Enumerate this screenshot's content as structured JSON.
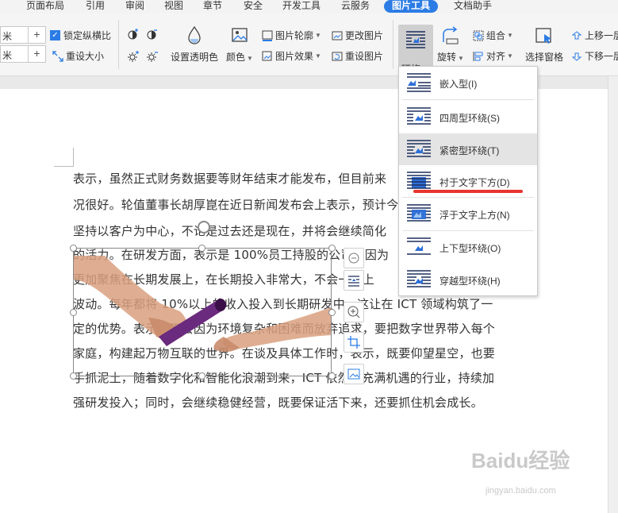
{
  "menu_tabs": [
    {
      "label": "页面布局"
    },
    {
      "label": "引用"
    },
    {
      "label": "审阅"
    },
    {
      "label": "视图"
    },
    {
      "label": "章节"
    },
    {
      "label": "安全"
    },
    {
      "label": "开发工具"
    },
    {
      "label": "云服务"
    },
    {
      "label": "图片工具",
      "active": true
    },
    {
      "label": "文档助手"
    }
  ],
  "ribbon": {
    "size_unit": "米",
    "lock_ratio": "锁定纵横比",
    "reset_size": "重设大小",
    "set_transparent": "设置透明色",
    "color": "颜色",
    "picture_outline": "图片轮廓",
    "picture_effect": "图片效果",
    "change_picture": "更改图片",
    "reset_picture": "重设图片",
    "wrap": "环绕",
    "rotate": "旋转",
    "group": "组合",
    "align": "对齐",
    "selection_pane": "选择窗格",
    "bring_forward": "上移一层",
    "send_backward": "下移一层"
  },
  "wrap_menu": {
    "items": [
      {
        "label": "嵌入型(I)"
      },
      {
        "label": "四周型环绕(S)"
      },
      {
        "label": "紧密型环绕(T)",
        "highlighted": true
      },
      {
        "label": "衬于文字下方(D)",
        "underlined": true
      },
      {
        "label": "浮于文字上方(N)"
      },
      {
        "label": "上下型环绕(O)"
      },
      {
        "label": "穿越型环绕(H)"
      }
    ]
  },
  "document": {
    "lines": [
      "表示，虽然正式财务数据要等财年结束才能发布，但目前来",
      "况很好。轮值董事长胡厚崑在近日新闻发布会上表示，预计今",
      "坚持以客户为中心，不论是过去还是现在，并将会继续简化",
      "的活力。在研发方面，表示是 100%员工持股的公司，因为",
      "更加聚焦在长期发展上，在长期投入非常大，不会一些上",
      "波动。每年都将 10%以上的收入投入到长期研发中，这让在 ICT 领域构筑了一",
      "定的优势。表示，不会因为环境复杂和困难而放弃追求，要把数字世界带入每个",
      "家庭，构建起万物互联的世界。在谈及具体工作时，表示，既要仰望星空，也要",
      "手抓泥土，随着数字化和智能化浪潮到来，ICT 依然是充满机遇的行业，持续加",
      "强研发投入；同时，会继续稳健经营，既要保证活下来，还要抓住机会成长。"
    ]
  },
  "watermark": {
    "text": "Baidu经验",
    "sub": "jingyan.baidu.com"
  },
  "colors": {
    "accent": "#2c7ce5",
    "underline": "#e8332f",
    "icon_navy": "#1d2f5c",
    "icon_blue": "#2e6fd8"
  }
}
